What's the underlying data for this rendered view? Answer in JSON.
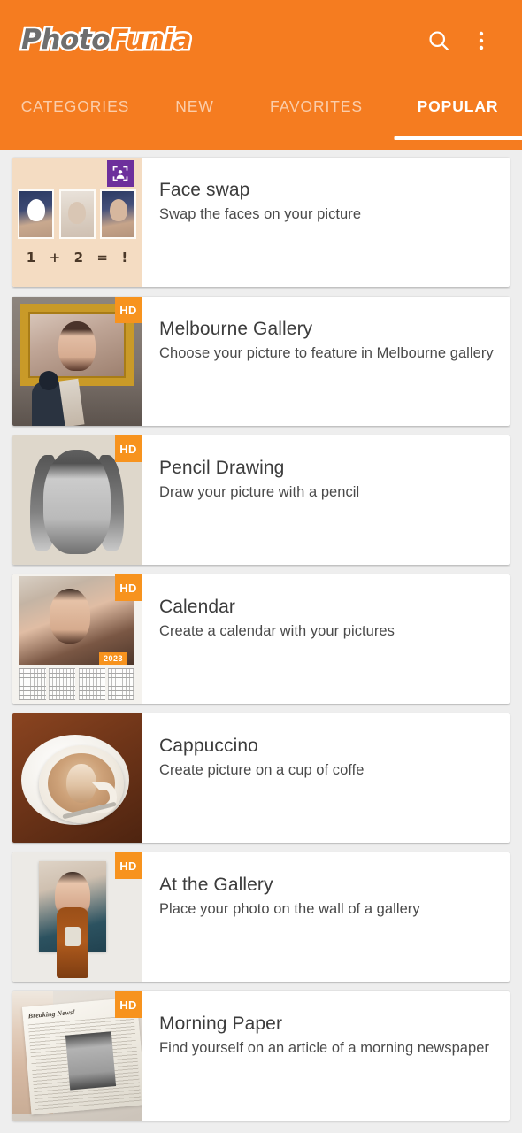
{
  "app": {
    "logo_first": "Photo",
    "logo_second": "Funia",
    "brand_orange": "#f57c20",
    "badge_orange": "#f7931e",
    "badge_purple": "#6d2f9c"
  },
  "appbar": {
    "search_icon": "search-icon",
    "overflow_icon": "more-vertical-icon"
  },
  "tabs": [
    {
      "label": "CATEGORIES",
      "active": false
    },
    {
      "label": "NEW",
      "active": false
    },
    {
      "label": "FAVORITES",
      "active": false
    },
    {
      "label": "POPULAR",
      "active": true
    }
  ],
  "effects": [
    {
      "title": "Face swap",
      "subtitle": "Swap the faces on your picture",
      "badge": "face",
      "badge_label": "",
      "thumb_caption": [
        "1",
        "+",
        "2",
        "=",
        "!"
      ]
    },
    {
      "title": "Melbourne Gallery",
      "subtitle": "Choose your picture to feature in Melbourne gallery",
      "badge": "hd",
      "badge_label": "HD"
    },
    {
      "title": "Pencil Drawing",
      "subtitle": "Draw your picture with a pencil",
      "badge": "hd",
      "badge_label": "HD"
    },
    {
      "title": "Calendar",
      "subtitle": "Create a calendar with your pictures",
      "badge": "hd",
      "badge_label": "HD",
      "thumb_year": "2023"
    },
    {
      "title": "Cappuccino",
      "subtitle": "Create picture on a cup of coffe",
      "badge": "none",
      "badge_label": ""
    },
    {
      "title": "At the Gallery",
      "subtitle": "Place your photo on the wall of a gallery",
      "badge": "hd",
      "badge_label": "HD"
    },
    {
      "title": "Morning Paper",
      "subtitle": "Find yourself on an article of a morning newspaper",
      "badge": "hd",
      "badge_label": "HD",
      "thumb_headline": "Breaking News!"
    }
  ]
}
